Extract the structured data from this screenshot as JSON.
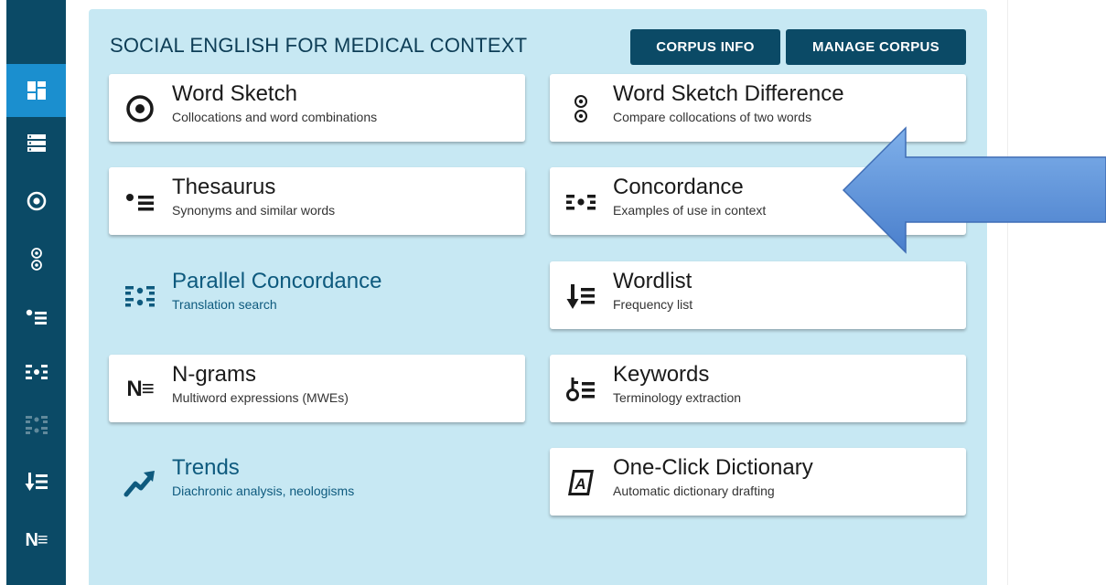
{
  "header": {
    "corpus_name": "SOCIAL ENGLISH FOR MEDICAL CONTEXT",
    "corpus_info_label": "CORPUS INFO",
    "manage_corpus_label": "MANAGE CORPUS"
  },
  "sidebar": {
    "items": [
      {
        "icon": "dashboard-icon",
        "active": true
      },
      {
        "icon": "list-icon"
      },
      {
        "icon": "word-sketch-icon"
      },
      {
        "icon": "word-sketch-difference-icon"
      },
      {
        "icon": "thesaurus-icon"
      },
      {
        "icon": "concordance-icon"
      },
      {
        "icon": "parallel-concordance-icon",
        "disabled": true
      },
      {
        "icon": "wordlist-icon"
      },
      {
        "icon": "ngrams-icon",
        "text": "N≡"
      }
    ]
  },
  "tools": {
    "word_sketch": {
      "title": "Word Sketch",
      "subtitle": "Collocations and word combinations",
      "icon": "target-icon"
    },
    "word_sketch_difference": {
      "title": "Word Sketch Difference",
      "subtitle": "Compare collocations of two words",
      "icon": "double-target-icon"
    },
    "thesaurus": {
      "title": "Thesaurus",
      "subtitle": "Synonyms and similar words",
      "icon": "thesaurus-icon"
    },
    "concordance": {
      "title": "Concordance",
      "subtitle": "Examples of use in context",
      "icon": "concordance-icon"
    },
    "parallel_concordance": {
      "title": "Parallel Concordance",
      "subtitle": "Translation search",
      "icon": "parallel-concordance-icon"
    },
    "wordlist": {
      "title": "Wordlist",
      "subtitle": "Frequency list",
      "icon": "wordlist-icon"
    },
    "ngrams": {
      "title": "N-grams",
      "subtitle": "Multiword expressions (MWEs)",
      "icon": "ngrams-icon",
      "icon_text": "N≡"
    },
    "keywords": {
      "title": "Keywords",
      "subtitle": "Terminology extraction",
      "icon": "keywords-icon"
    },
    "trends": {
      "title": "Trends",
      "subtitle": "Diachronic analysis, neologisms",
      "icon": "trend-arrow-icon"
    },
    "one_click_dictionary": {
      "title": "One-Click Dictionary",
      "subtitle": "Automatic dictionary drafting",
      "icon": "dictionary-icon",
      "icon_text": "A"
    }
  },
  "annotation": {
    "icon": "pointer-arrow-icon",
    "color": "#5b8fd8",
    "points_to": "concordance"
  },
  "colors": {
    "sidebar": "#0b4a66",
    "sidebar_active": "#1b8fcf",
    "panel": "#c7e8f3",
    "button": "#0b4a66",
    "link_text": "#0e5a7e"
  }
}
